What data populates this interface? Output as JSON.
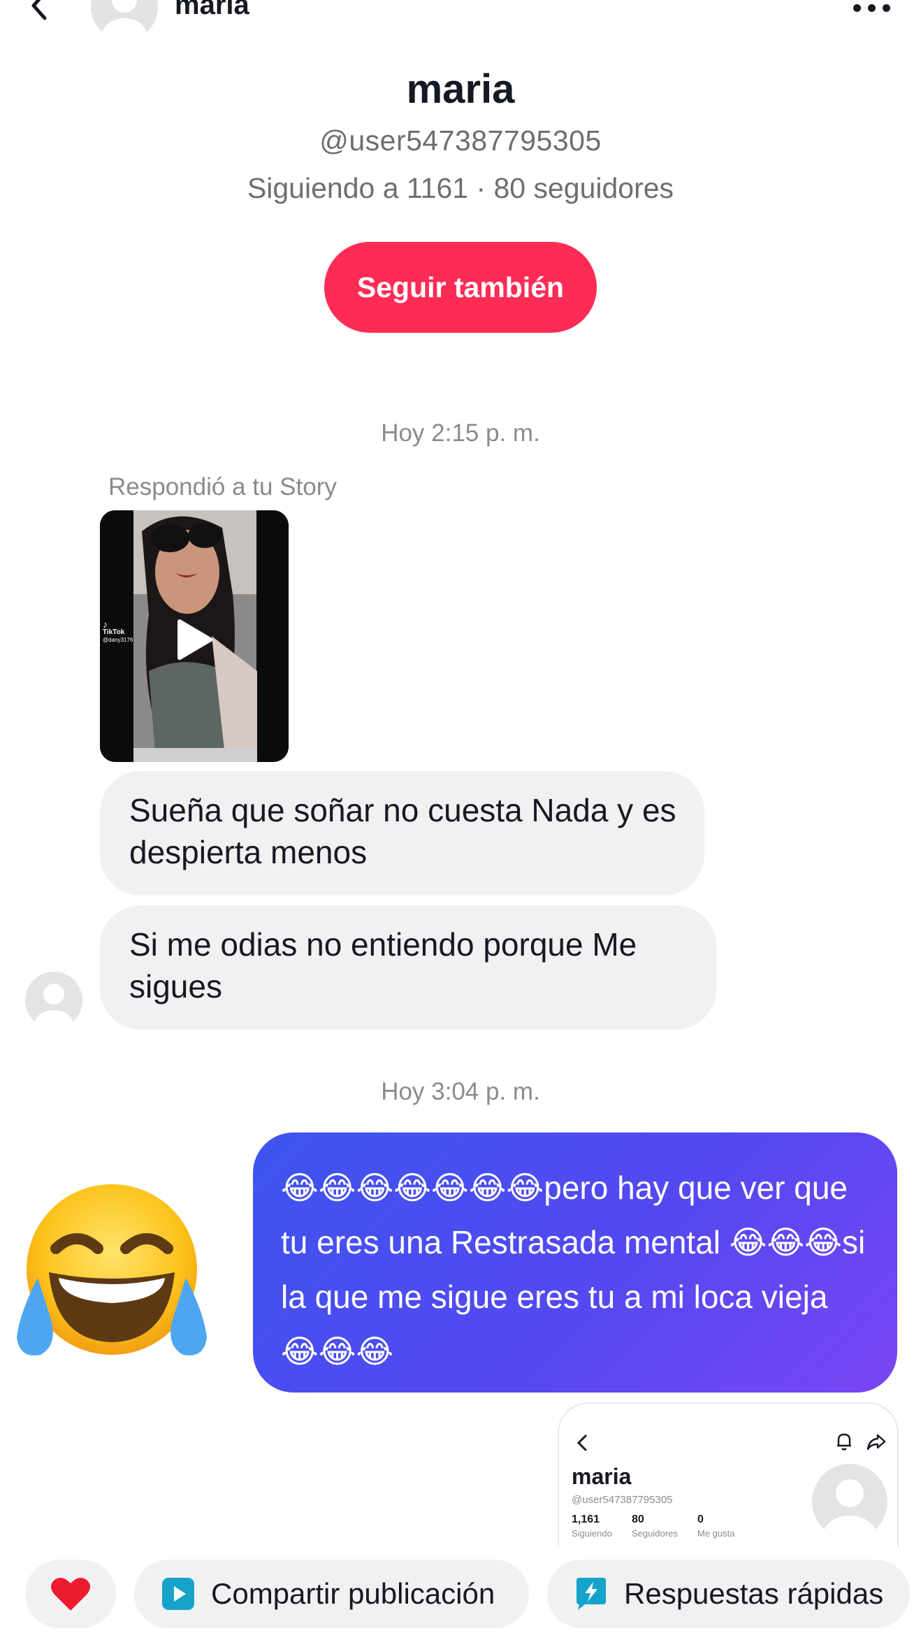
{
  "header": {
    "name": "maria",
    "back_icon": "chevron-left-icon",
    "more_icon": "more-dots-icon"
  },
  "profile": {
    "name": "maria",
    "handle": "@user547387795305",
    "stats": "Siguiendo a 1161 · 80 seguidores",
    "follow_label": "Seguir también",
    "follow_color": "#fe2c55"
  },
  "chat": {
    "timestamp_1": "Hoy 2:15 p. m.",
    "story_note": "Respondió a tu Story",
    "story_watermark": "TikTok",
    "story_watermark_user": "@dany3176",
    "message_1": " Sueña que soñar no cuesta Nada y es despierta menos",
    "message_2": "Si me odias no entiendo porque  Me sigues",
    "timestamp_2": "Hoy 3:04 p. m.",
    "sent_message": "😂😂😂😂😂😂😂pero hay que ver que tu eres una Restrasada mental 😂😂😂si la que me sigue eres tu a mi loca vieja 😂😂😂",
    "big_emoji": "😂",
    "sent_gradient": [
      "#3d55ef",
      "#7a46f5"
    ],
    "received_bubble_color": "#f1f1f2"
  },
  "shared_card": {
    "name": "maria",
    "handle": "@user547387795305",
    "following_count": "1,161",
    "following_label": "Siguiendo",
    "followers_count": "80",
    "followers_label": "Seguidores",
    "likes_count": "0",
    "likes_label": "Me gusta"
  },
  "bottom_bar": {
    "heart_icon": "heart-icon",
    "share_label": "Compartir publicación",
    "quick_label": "Respuestas rápidas",
    "share_icon_color": "#16a3c9",
    "quick_icon_color": "#16a3c9"
  }
}
